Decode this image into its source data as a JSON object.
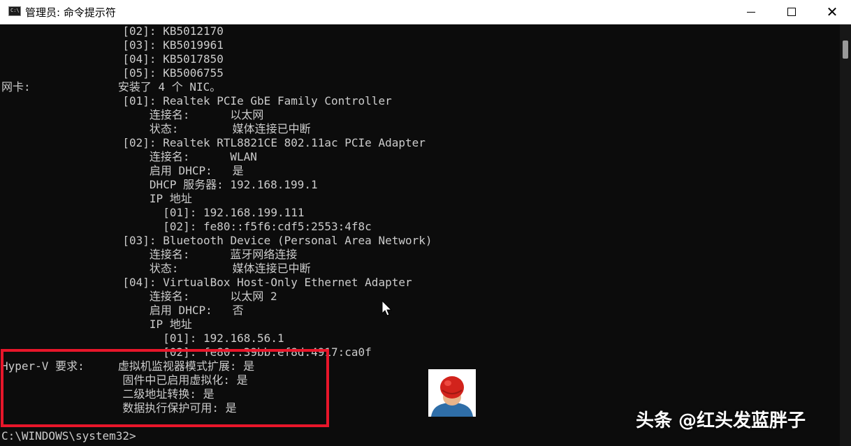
{
  "window": {
    "title": "管理员: 命令提示符",
    "app_icon_text": "C:\\",
    "buttons": {
      "minimize": "minimize-icon",
      "maximize": "maximize-icon",
      "close": "close-icon"
    },
    "close_glyph": "✕"
  },
  "console": {
    "lines": [
      "                  [02]: KB5012170",
      "                  [03]: KB5019961",
      "                  [04]: KB5017850",
      "                  [05]: KB5006755",
      "网卡:             安装了 4 个 NIC。",
      "                  [01]: Realtek PCIe GbE Family Controller",
      "                      连接名:      以太网",
      "                      状态:        媒体连接已中断",
      "                  [02]: Realtek RTL8821CE 802.11ac PCIe Adapter",
      "                      连接名:      WLAN",
      "                      启用 DHCP:   是",
      "                      DHCP 服务器: 192.168.199.1",
      "                      IP 地址",
      "                        [01]: 192.168.199.111",
      "                        [02]: fe80::f5f6:cdf5:2553:4f8c",
      "                  [03]: Bluetooth Device (Personal Area Network)",
      "                      连接名:      蓝牙网络连接",
      "                      状态:        媒体连接已中断",
      "                  [04]: VirtualBox Host-Only Ethernet Adapter",
      "                      连接名:      以太网 2",
      "                      启用 DHCP:   否",
      "                      IP 地址",
      "                        [01]: 192.168.56.1",
      "                        [02]: fe80::39bb:ef8d:4917:ca0f",
      "Hyper-V 要求:     虚拟机监视器模式扩展: 是",
      "                  固件中已启用虚拟化: 是",
      "                  二级地址转换: 是",
      "                  数据执行保护可用: 是",
      "",
      "C:\\WINDOWS\\system32>"
    ]
  },
  "colors": {
    "console_bg": "#0c0c0c",
    "console_text": "#cccccc",
    "highlight": "#e8162a"
  },
  "watermark": {
    "text": "头条 @红头发蓝胖子"
  },
  "overlay": {
    "avatar_icon": "avatar-red-hair-icon",
    "cursor_icon": "mouse-pointer-icon"
  }
}
